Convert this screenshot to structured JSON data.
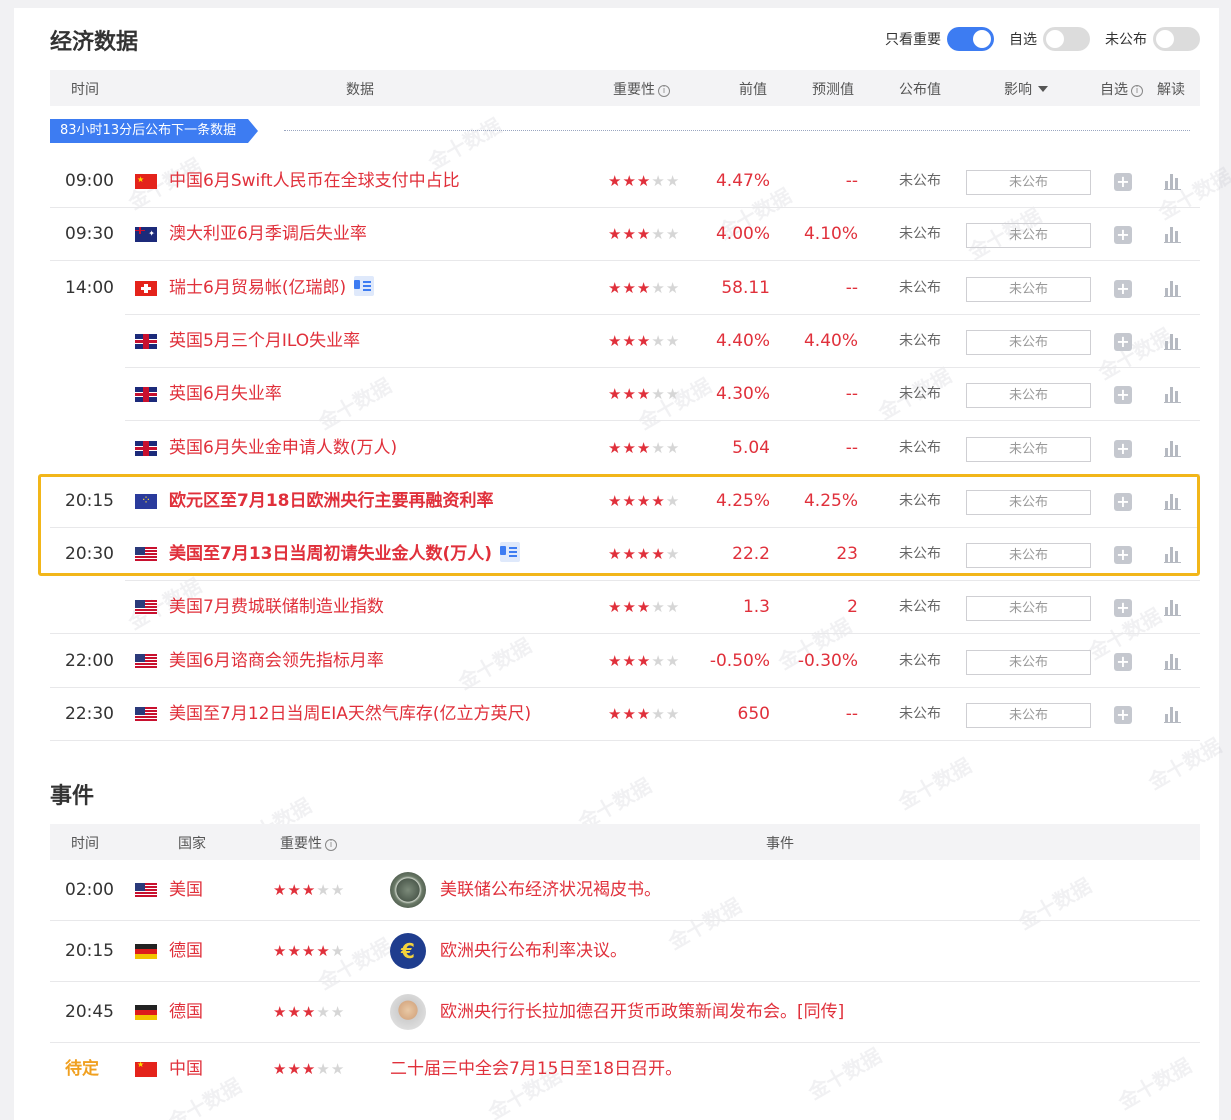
{
  "econ": {
    "title": "经济数据",
    "toggles": [
      {
        "label": "只看重要",
        "on": true
      },
      {
        "label": "自选",
        "on": false
      },
      {
        "label": "未公布",
        "on": false
      }
    ],
    "headers": {
      "time": "时间",
      "data": "数据",
      "importance": "重要性",
      "prev": "前值",
      "forecast": "预测值",
      "actual": "公布值",
      "impact": "影响",
      "watch": "自选",
      "interpret": "解读"
    },
    "countdown": "83小时13分后公布下一条数据",
    "rows": [
      {
        "time": "09:00",
        "flag": "cn",
        "name": "中国6月Swift人民币在全球支付中占比",
        "stars": 3,
        "prev": "4.47%",
        "forecast": "--",
        "actual": "未公布",
        "impact": "未公布",
        "bold": false,
        "doc": false
      },
      {
        "time": "09:30",
        "flag": "au",
        "name": "澳大利亚6月季调后失业率",
        "stars": 3,
        "prev": "4.00%",
        "forecast": "4.10%",
        "actual": "未公布",
        "impact": "未公布",
        "bold": false,
        "doc": false
      },
      {
        "time": "14:00",
        "flag": "ch",
        "name": "瑞士6月贸易帐(亿瑞郎)",
        "stars": 3,
        "prev": "58.11",
        "forecast": "--",
        "actual": "未公布",
        "impact": "未公布",
        "bold": false,
        "doc": true
      },
      {
        "time": "",
        "flag": "gb",
        "name": "英国5月三个月ILO失业率",
        "stars": 3,
        "prev": "4.40%",
        "forecast": "4.40%",
        "actual": "未公布",
        "impact": "未公布",
        "bold": false,
        "doc": false
      },
      {
        "time": "",
        "flag": "gb",
        "name": "英国6月失业率",
        "stars": 3,
        "prev": "4.30%",
        "forecast": "--",
        "actual": "未公布",
        "impact": "未公布",
        "bold": false,
        "doc": false
      },
      {
        "time": "",
        "flag": "gb",
        "name": "英国6月失业金申请人数(万人)",
        "stars": 3,
        "prev": "5.04",
        "forecast": "--",
        "actual": "未公布",
        "impact": "未公布",
        "bold": false,
        "doc": false
      },
      {
        "time": "20:15",
        "flag": "eu",
        "name": "欧元区至7月18日欧洲央行主要再融资利率",
        "stars": 4,
        "prev": "4.25%",
        "forecast": "4.25%",
        "actual": "未公布",
        "impact": "未公布",
        "bold": true,
        "doc": false
      },
      {
        "time": "20:30",
        "flag": "us",
        "name": "美国至7月13日当周初请失业金人数(万人)",
        "stars": 4,
        "prev": "22.2",
        "forecast": "23",
        "actual": "未公布",
        "impact": "未公布",
        "bold": true,
        "doc": true
      },
      {
        "time": "",
        "flag": "us",
        "name": "美国7月费城联储制造业指数",
        "stars": 3,
        "prev": "1.3",
        "forecast": "2",
        "actual": "未公布",
        "impact": "未公布",
        "bold": false,
        "doc": false
      },
      {
        "time": "22:00",
        "flag": "us",
        "name": "美国6月谘商会领先指标月率",
        "stars": 3,
        "prev": "-0.50%",
        "forecast": "-0.30%",
        "actual": "未公布",
        "impact": "未公布",
        "bold": false,
        "doc": false
      },
      {
        "time": "22:30",
        "flag": "us",
        "name": "美国至7月12日当周EIA天然气库存(亿立方英尺)",
        "stars": 3,
        "prev": "650",
        "forecast": "--",
        "actual": "未公布",
        "impact": "未公布",
        "bold": false,
        "doc": false
      }
    ]
  },
  "events": {
    "title": "事件",
    "headers": {
      "time": "时间",
      "country": "国家",
      "importance": "重要性",
      "event": "事件"
    },
    "rows": [
      {
        "time": "02:00",
        "flag": "us",
        "country": "美国",
        "stars": 3,
        "avatar": "seal",
        "text": "美联储公布经济状况褐皮书。",
        "pending": false
      },
      {
        "time": "20:15",
        "flag": "de",
        "country": "德国",
        "stars": 4,
        "avatar": "euro",
        "text": "欧洲央行公布利率决议。",
        "pending": false
      },
      {
        "time": "20:45",
        "flag": "de",
        "country": "德国",
        "stars": 3,
        "avatar": "face",
        "text": "欧洲央行行长拉加德召开货币政策新闻发布会。[同传]",
        "pending": false
      },
      {
        "time": "待定",
        "flag": "cn",
        "country": "中国",
        "stars": 3,
        "avatar": "",
        "text": "二十届三中全会7月15日至18日召开。",
        "pending": true
      }
    ]
  },
  "watermark": "金十数据",
  "colors": {
    "accent": "#3d7cf2",
    "red": "#e0303b",
    "highlight": "#f2b619",
    "pending": "#f0a020"
  }
}
